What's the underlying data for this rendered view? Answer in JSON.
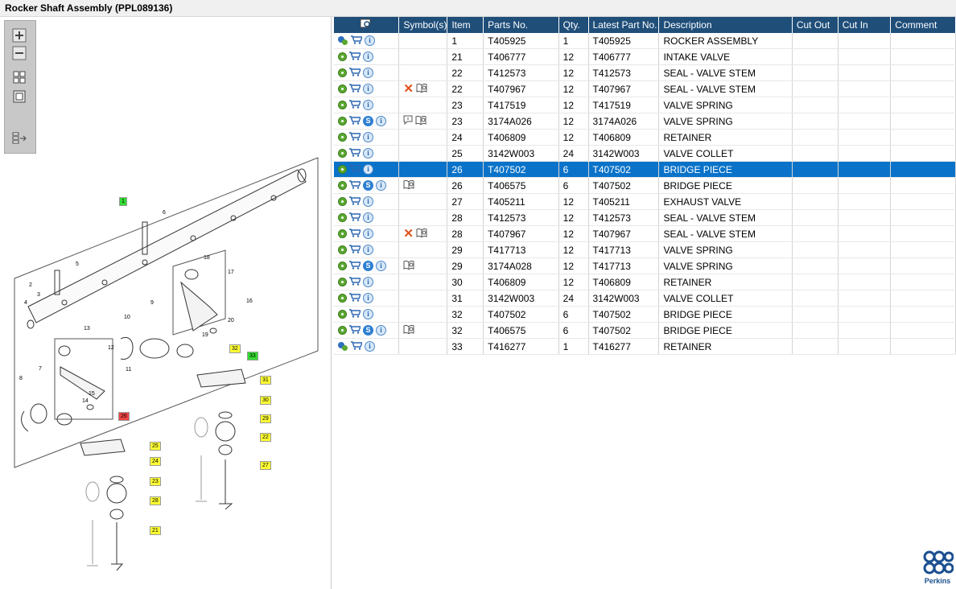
{
  "window": {
    "title": "Rocker Shaft Assembly (PPL089136)"
  },
  "toolbar": {
    "icons": [
      "zoom-in-icon",
      "zoom-out-icon",
      "fit-all-icon",
      "actual-size-icon",
      "toggle-list-icon"
    ]
  },
  "diagram": {
    "callouts": [
      {
        "label": "1",
        "color": "#33dd33"
      },
      {
        "label": "6",
        "color": "#ffffff"
      },
      {
        "label": "2",
        "color": "#ffffff"
      },
      {
        "label": "3",
        "color": "#ffffff"
      },
      {
        "label": "4",
        "color": "#ffffff"
      },
      {
        "label": "5",
        "color": "#ffffff"
      },
      {
        "label": "7",
        "color": "#ffffff"
      },
      {
        "label": "8",
        "color": "#ffffff"
      },
      {
        "label": "9",
        "color": "#ffffff"
      },
      {
        "label": "10",
        "color": "#ffffff"
      },
      {
        "label": "11",
        "color": "#ffffff"
      },
      {
        "label": "12",
        "color": "#ffffff"
      },
      {
        "label": "13",
        "color": "#ffffff"
      },
      {
        "label": "14",
        "color": "#ffffff"
      },
      {
        "label": "15",
        "color": "#ffffff"
      },
      {
        "label": "16",
        "color": "#ffffff"
      },
      {
        "label": "17",
        "color": "#ffffff"
      },
      {
        "label": "18",
        "color": "#ffffff"
      },
      {
        "label": "19",
        "color": "#ffffff"
      },
      {
        "label": "20",
        "color": "#ffffff"
      },
      {
        "label": "26",
        "color": "#ee4444"
      },
      {
        "label": "25",
        "color": "#ffff33"
      },
      {
        "label": "24",
        "color": "#ffff33"
      },
      {
        "label": "23",
        "color": "#ffff33"
      },
      {
        "label": "28",
        "color": "#ffff33"
      },
      {
        "label": "21",
        "color": "#ffff33"
      },
      {
        "label": "32",
        "color": "#ffff33"
      },
      {
        "label": "33",
        "color": "#33dd33"
      },
      {
        "label": "31",
        "color": "#ffff33"
      },
      {
        "label": "30",
        "color": "#ffff33"
      },
      {
        "label": "29",
        "color": "#ffff33"
      },
      {
        "label": "22",
        "color": "#ffff33"
      },
      {
        "label": "27",
        "color": "#ffff33"
      }
    ]
  },
  "table": {
    "headers": [
      "",
      "Symbol(s)",
      "Item",
      "Parts No.",
      "Qty.",
      "Latest Part No.",
      "Description",
      "Cut Out",
      "Cut In",
      "Comment"
    ],
    "header_icon": "find-in-diagram-icon",
    "rows": [
      {
        "icons": [
          "gears",
          "cart",
          "info"
        ],
        "sym": [],
        "item": "1",
        "part": "T405925",
        "qty": "1",
        "latest": "T405925",
        "desc": "ROCKER ASSEMBLY",
        "sel": false
      },
      {
        "icons": [
          "gear",
          "cart",
          "info"
        ],
        "sym": [],
        "item": "21",
        "part": "T406777",
        "qty": "12",
        "latest": "T406777",
        "desc": "INTAKE VALVE",
        "sel": false
      },
      {
        "icons": [
          "gear",
          "cart",
          "info"
        ],
        "sym": [],
        "item": "22",
        "part": "T412573",
        "qty": "12",
        "latest": "T412573",
        "desc": "SEAL - VALVE STEM",
        "sel": false
      },
      {
        "icons": [
          "gear",
          "cart",
          "info"
        ],
        "sym": [
          "x",
          "book"
        ],
        "item": "22",
        "part": "T407967",
        "qty": "12",
        "latest": "T407967",
        "desc": "SEAL - VALVE STEM",
        "sel": false
      },
      {
        "icons": [
          "gear",
          "cart",
          "info"
        ],
        "sym": [],
        "item": "23",
        "part": "T417519",
        "qty": "12",
        "latest": "T417519",
        "desc": "VALVE SPRING",
        "sel": false
      },
      {
        "icons": [
          "gear",
          "cart",
          "s",
          "info"
        ],
        "sym": [
          "bubble",
          "book"
        ],
        "item": "23",
        "part": "3174A026",
        "qty": "12",
        "latest": "3174A026",
        "desc": "VALVE SPRING",
        "sel": false
      },
      {
        "icons": [
          "gear",
          "cart",
          "info"
        ],
        "sym": [],
        "item": "24",
        "part": "T406809",
        "qty": "12",
        "latest": "T406809",
        "desc": "RETAINER",
        "sel": false
      },
      {
        "icons": [
          "gear",
          "cart",
          "info"
        ],
        "sym": [],
        "item": "25",
        "part": "3142W003",
        "qty": "24",
        "latest": "3142W003",
        "desc": "VALVE COLLET",
        "sel": false
      },
      {
        "icons": [
          "gear",
          "cart",
          "info"
        ],
        "sym": [],
        "item": "26",
        "part": "T407502",
        "qty": "6",
        "latest": "T407502",
        "desc": "BRIDGE PIECE",
        "sel": true
      },
      {
        "icons": [
          "gear",
          "cart",
          "s",
          "info"
        ],
        "sym": [
          "book"
        ],
        "item": "26",
        "part": "T406575",
        "qty": "6",
        "latest": "T407502",
        "desc": "BRIDGE PIECE",
        "sel": false
      },
      {
        "icons": [
          "gear",
          "cart",
          "info"
        ],
        "sym": [],
        "item": "27",
        "part": "T405211",
        "qty": "12",
        "latest": "T405211",
        "desc": "EXHAUST VALVE",
        "sel": false
      },
      {
        "icons": [
          "gear",
          "cart",
          "info"
        ],
        "sym": [],
        "item": "28",
        "part": "T412573",
        "qty": "12",
        "latest": "T412573",
        "desc": "SEAL - VALVE STEM",
        "sel": false
      },
      {
        "icons": [
          "gear",
          "cart",
          "info"
        ],
        "sym": [
          "x",
          "book"
        ],
        "item": "28",
        "part": "T407967",
        "qty": "12",
        "latest": "T407967",
        "desc": "SEAL - VALVE STEM",
        "sel": false
      },
      {
        "icons": [
          "gear",
          "cart",
          "info"
        ],
        "sym": [],
        "item": "29",
        "part": "T417713",
        "qty": "12",
        "latest": "T417713",
        "desc": "VALVE SPRING",
        "sel": false
      },
      {
        "icons": [
          "gear",
          "cart",
          "s",
          "info"
        ],
        "sym": [
          "book"
        ],
        "item": "29",
        "part": "3174A028",
        "qty": "12",
        "latest": "T417713",
        "desc": "VALVE SPRING",
        "sel": false
      },
      {
        "icons": [
          "gear",
          "cart",
          "info"
        ],
        "sym": [],
        "item": "30",
        "part": "T406809",
        "qty": "12",
        "latest": "T406809",
        "desc": "RETAINER",
        "sel": false
      },
      {
        "icons": [
          "gear",
          "cart",
          "info"
        ],
        "sym": [],
        "item": "31",
        "part": "3142W003",
        "qty": "24",
        "latest": "3142W003",
        "desc": "VALVE COLLET",
        "sel": false
      },
      {
        "icons": [
          "gear",
          "cart",
          "info"
        ],
        "sym": [],
        "item": "32",
        "part": "T407502",
        "qty": "6",
        "latest": "T407502",
        "desc": "BRIDGE PIECE",
        "sel": false
      },
      {
        "icons": [
          "gear",
          "cart",
          "s",
          "info"
        ],
        "sym": [
          "book"
        ],
        "item": "32",
        "part": "T406575",
        "qty": "6",
        "latest": "T407502",
        "desc": "BRIDGE PIECE",
        "sel": false
      },
      {
        "icons": [
          "gears",
          "cart",
          "info"
        ],
        "sym": [],
        "item": "33",
        "part": "T416277",
        "qty": "1",
        "latest": "T416277",
        "desc": "RETAINER",
        "sel": false
      }
    ]
  },
  "brand": {
    "name": "Perkins",
    "color": "#1a4f8f"
  },
  "colors": {
    "header": "#1f4e79",
    "selected": "#0a73c9"
  }
}
